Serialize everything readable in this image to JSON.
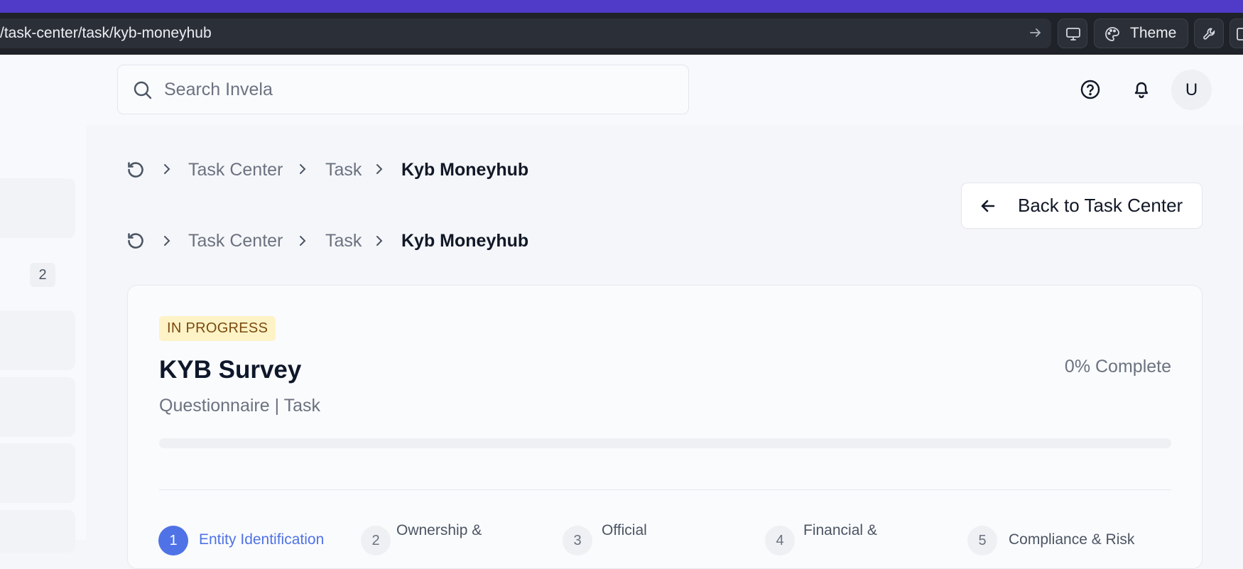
{
  "browser": {
    "url": "/task-center/task/kyb-moneyhub",
    "theme_label": "Theme"
  },
  "header": {
    "search_placeholder": "Search Invela",
    "avatar_initial": "U"
  },
  "sidebar": {
    "badge_count": "2"
  },
  "breadcrumb": {
    "items": [
      "Task Center",
      "Task",
      "Kyb Moneyhub"
    ]
  },
  "back_button": {
    "label": "Back to Task Center"
  },
  "task": {
    "status": "IN PROGRESS",
    "title": "KYB Survey",
    "subtitle": "Questionnaire | Task",
    "progress_label": "0% Complete",
    "progress_fraction": 0
  },
  "steps": [
    {
      "number": "1",
      "label": "Entity Identification"
    },
    {
      "number": "2",
      "label": "Ownership &"
    },
    {
      "number": "3",
      "label": "Official"
    },
    {
      "number": "4",
      "label": "Financial &"
    },
    {
      "number": "5",
      "label": "Compliance & Risk"
    }
  ],
  "colors": {
    "accent": "#4f73e6",
    "browser_top": "#4f3bc8",
    "badge_bg": "#fdf3c7",
    "badge_text": "#7a4a0e"
  }
}
